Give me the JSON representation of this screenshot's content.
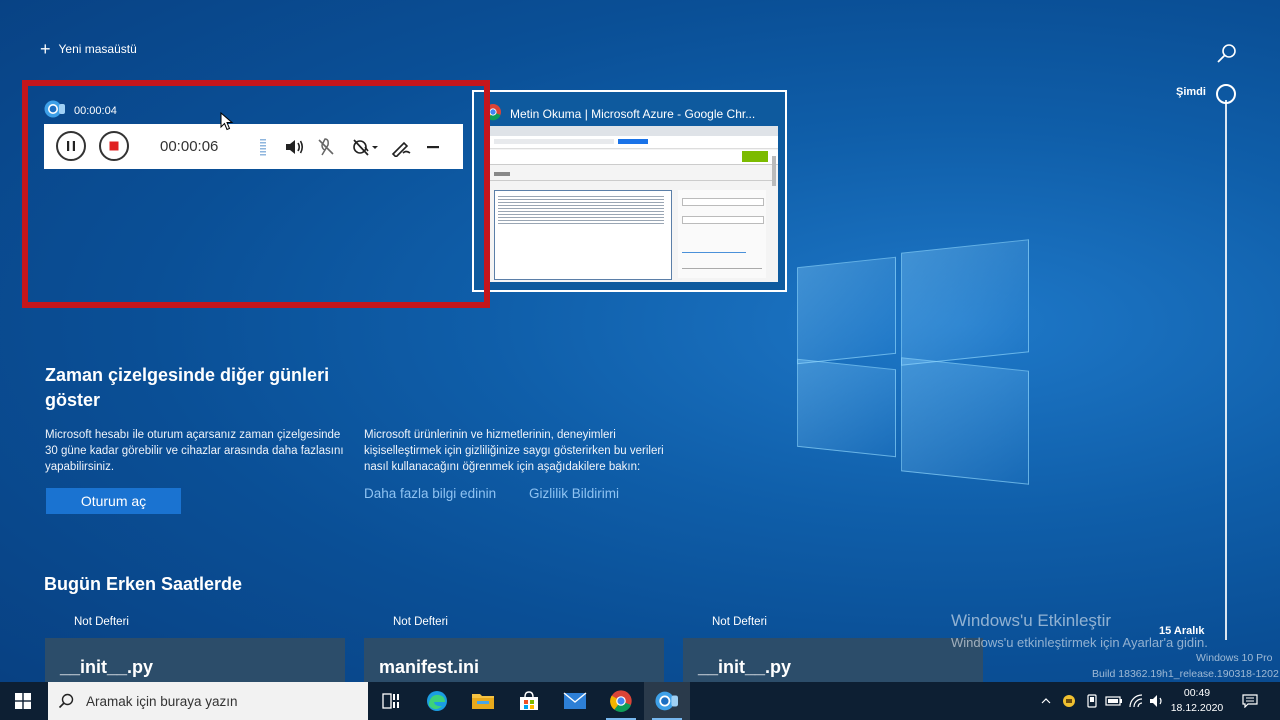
{
  "top": {
    "new_desktop_label": "Yeni masaüstü"
  },
  "timeline": {
    "now_label": "Şimdi",
    "date_label": "15 Aralık"
  },
  "recorder": {
    "elapsed_title": "00:00:04",
    "timer": "00:00:06",
    "highlight_color": "#c4161c"
  },
  "chrome_window": {
    "title": "Metin Okuma | Microsoft Azure - Google Chr..."
  },
  "timeline_info": {
    "title": "Zaman çizelgesinde diğer günleri göster",
    "left_text": "Microsoft hesabı ile oturum açarsanız zaman çizelgesinde 30 güne kadar görebilir ve cihazlar arasında daha fazlasını yapabilirsiniz.",
    "signin_button": "Oturum aç",
    "right_text": "Microsoft ürünlerinin ve hizmetlerinin, deneyimleri kişiselleştirmek için gizliliğinize saygı gösterirken bu verileri nasıl kullanacağını öğrenmek için aşağıdakilere bakın:",
    "learn_more_link": "Daha fazla bilgi edinin",
    "privacy_link": "Gizlilik Bildirimi"
  },
  "today": {
    "title": "Bugün Erken Saatlerde",
    "cards": [
      {
        "app": "Not Defteri",
        "file": "__init__.py"
      },
      {
        "app": "Not Defteri",
        "file": "manifest.ini"
      },
      {
        "app": "Not Defteri",
        "file": "__init__.py"
      }
    ]
  },
  "watermark": {
    "title": "Windows'u Etkinleştir",
    "subtitle": "Windows'u etkinleştirmek için Ayarlar'a gidin.",
    "edition": "Windows 10 Pro",
    "build": "Build 18362.19h1_release.190318-1202"
  },
  "taskbar": {
    "search_placeholder": "Aramak için buraya yazın",
    "time": "00:49",
    "date": "18.12.2020",
    "icons": [
      "task-view-icon",
      "edge-icon",
      "file-explorer-icon",
      "store-icon",
      "mail-icon",
      "chrome-icon",
      "camera-icon"
    ]
  }
}
